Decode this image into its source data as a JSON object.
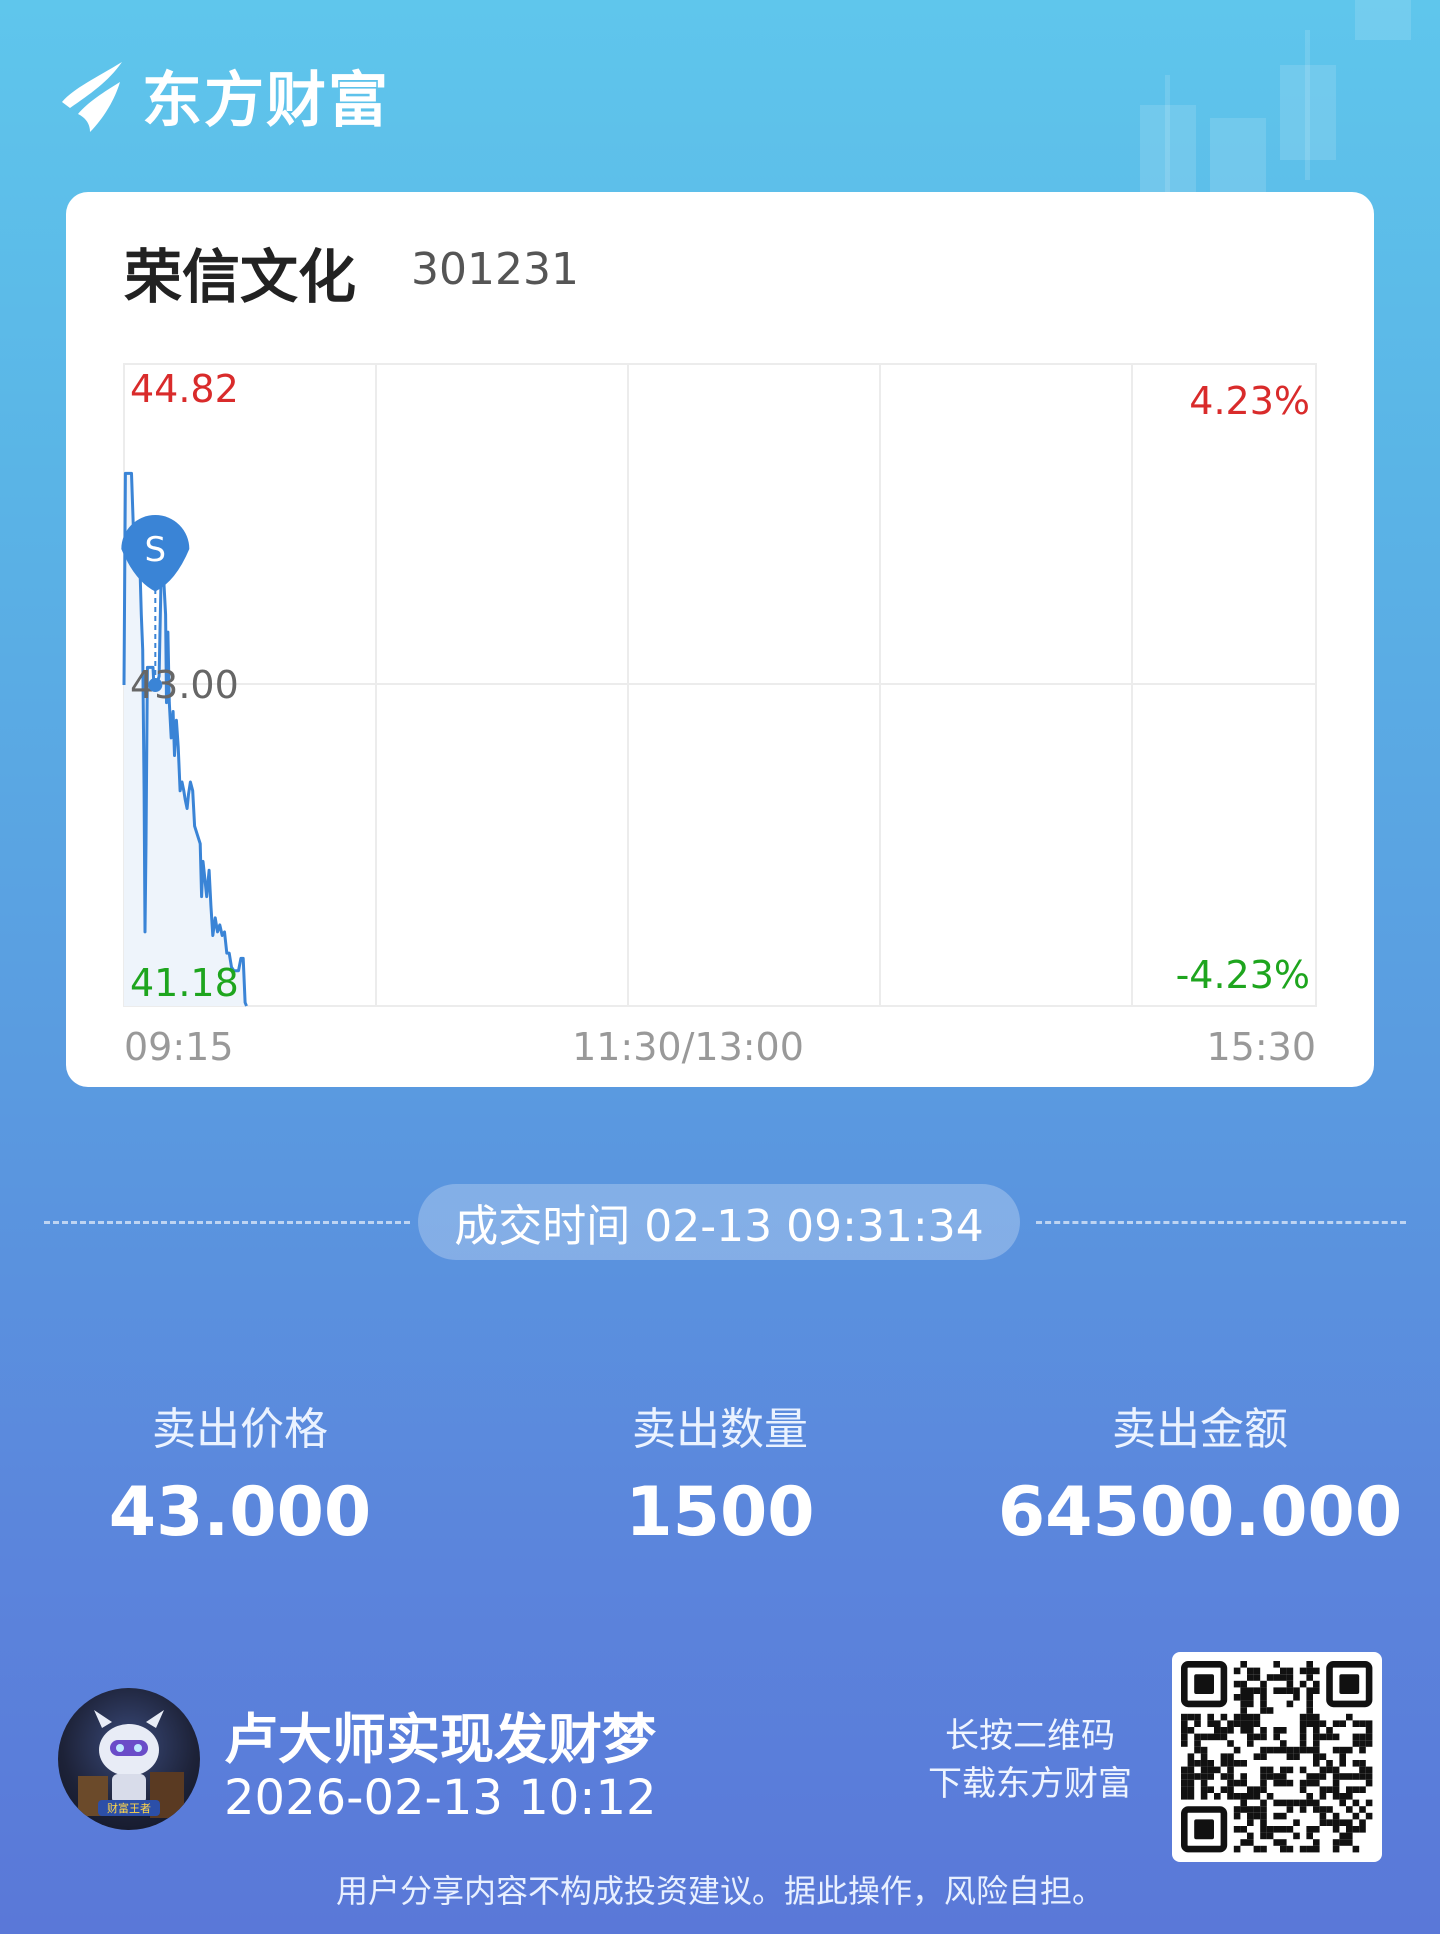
{
  "brand": {
    "name": "东方财富"
  },
  "stock": {
    "name": "荣信文化",
    "code": "301231"
  },
  "chart_data": {
    "type": "line",
    "title": "",
    "price_max_label": "44.82",
    "price_mid_label": "43.00",
    "price_min_label": "41.18",
    "pct_max_label": "4.23%",
    "pct_min_label": "-4.23%",
    "x_tick_labels": [
      "09:15",
      "11:30/13:00",
      "15:30"
    ],
    "ylim": [
      41.18,
      44.82
    ],
    "x_range_minutes": [
      0,
      255
    ],
    "colors": {
      "up": "#d92b2b",
      "down": "#1ea51e",
      "line": "#3a84d6",
      "fill": "#eef4fb"
    },
    "series": [
      {
        "values": [
          [
            0.0,
            43.0
          ],
          [
            0.3,
            44.2
          ],
          [
            1.0,
            44.2
          ],
          [
            1.6,
            44.2
          ],
          [
            2.0,
            43.9
          ],
          [
            2.4,
            43.9
          ],
          [
            2.8,
            43.7
          ],
          [
            3.3,
            43.78
          ],
          [
            3.7,
            43.4
          ],
          [
            4.0,
            43.2
          ],
          [
            4.3,
            42.4
          ],
          [
            4.5,
            41.6
          ],
          [
            4.7,
            42.1
          ],
          [
            5.0,
            43.1
          ],
          [
            5.4,
            43.1
          ],
          [
            5.9,
            43.1
          ],
          [
            6.2,
            43.1
          ],
          [
            6.4,
            43.0
          ],
          [
            6.7,
            43.0
          ],
          [
            7.0,
            43.0
          ],
          [
            7.5,
            43.05
          ],
          [
            8.0,
            43.7
          ],
          [
            8.5,
            43.6
          ],
          [
            8.9,
            43.4
          ],
          [
            9.1,
            42.9
          ],
          [
            9.4,
            43.3
          ],
          [
            9.7,
            42.9
          ],
          [
            10.1,
            42.7
          ],
          [
            10.5,
            42.85
          ],
          [
            10.8,
            42.6
          ],
          [
            11.2,
            42.8
          ],
          [
            11.6,
            42.65
          ],
          [
            12.0,
            42.4
          ],
          [
            12.4,
            42.45
          ],
          [
            12.8,
            42.4
          ],
          [
            13.1,
            42.35
          ],
          [
            13.5,
            42.3
          ],
          [
            13.8,
            42.38
          ],
          [
            14.2,
            42.45
          ],
          [
            14.7,
            42.4
          ],
          [
            15.1,
            42.2
          ],
          [
            15.7,
            42.15
          ],
          [
            16.3,
            42.1
          ],
          [
            16.6,
            41.8
          ],
          [
            16.9,
            42.0
          ],
          [
            17.3,
            41.9
          ],
          [
            17.7,
            41.8
          ],
          [
            18.2,
            41.95
          ],
          [
            18.6,
            41.75
          ],
          [
            19.0,
            41.58
          ],
          [
            19.5,
            41.68
          ],
          [
            20.0,
            41.6
          ],
          [
            20.5,
            41.64
          ],
          [
            21.0,
            41.58
          ],
          [
            21.5,
            41.6
          ],
          [
            22.0,
            41.48
          ],
          [
            22.5,
            41.48
          ],
          [
            23.0,
            41.4
          ],
          [
            23.5,
            41.38
          ],
          [
            24.0,
            41.38
          ],
          [
            24.5,
            41.38
          ],
          [
            25.0,
            41.45
          ],
          [
            25.5,
            41.45
          ],
          [
            25.9,
            41.2
          ],
          [
            26.2,
            41.18
          ]
        ]
      }
    ],
    "marker": {
      "label": "S",
      "x": 6.7,
      "y": 43.0
    }
  },
  "trade": {
    "time_label": "成交时间 02-13 09:31:34",
    "stats": [
      {
        "label": "卖出价格",
        "value": "43.000"
      },
      {
        "label": "卖出数量",
        "value": "1500"
      },
      {
        "label": "卖出金额",
        "value": "64500.000"
      }
    ]
  },
  "user": {
    "name": "卢大师实现发财梦",
    "time": "2026-02-13 10:12",
    "badge": "财富王者"
  },
  "qr": {
    "hint_line1": "长按二维码",
    "hint_line2": "下载东方财富",
    "icon": "qr-code-icon"
  },
  "footer": {
    "disclaimer": "用户分享内容不构成投资建议。据此操作，风险自担。"
  }
}
